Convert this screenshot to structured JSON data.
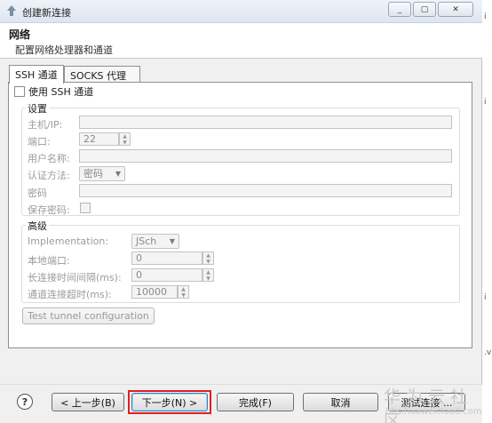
{
  "window": {
    "title": "创建新连接",
    "minimize_glyph": "_",
    "maximize_glyph": "▢",
    "close_glyph": "✕"
  },
  "header": {
    "title": "网络",
    "description": "配置网络处理器和通道"
  },
  "tabs": [
    {
      "label": "SSH 通道",
      "active": true
    },
    {
      "label": "SOCKS 代理",
      "active": false
    }
  ],
  "use_ssh": {
    "label": "使用 SSH 通道",
    "checked": false
  },
  "settings": {
    "group_label": "设置",
    "host_label": "主机/IP:",
    "host_value": "",
    "port_label": "端口:",
    "port_value": "22",
    "user_label": "用户名称:",
    "user_value": "",
    "auth_label": "认证方法:",
    "auth_value": "密码",
    "password_label": "密码",
    "password_value": "",
    "save_password_label": "保存密码:",
    "save_password_checked": false
  },
  "advanced": {
    "group_label": "高级",
    "impl_label": "Implementation:",
    "impl_value": "JSch",
    "local_port_label": "本地端口:",
    "local_port_value": "0",
    "keepalive_label": "长连接时间间隔(ms):",
    "keepalive_value": "0",
    "timeout_label": "通道连接超时(ms):",
    "timeout_value": "10000"
  },
  "test_tunnel_label": "Test tunnel configuration",
  "footer": {
    "help_glyph": "?",
    "back_label": "< 上一步(B)",
    "next_label": "下一步(N) >",
    "finish_label": "完成(F)",
    "cancel_label": "取消",
    "test_connection_label": "测试连接 ..."
  },
  "watermark": {
    "title": "华为云社区",
    "url": "bbs.huaweicloud.com"
  },
  "edge_fragments": [
    "i",
    "i",
    "i",
    ".v"
  ],
  "colors": {
    "highlight_border": "#e02020",
    "disabled_text": "#9b9b9b"
  }
}
